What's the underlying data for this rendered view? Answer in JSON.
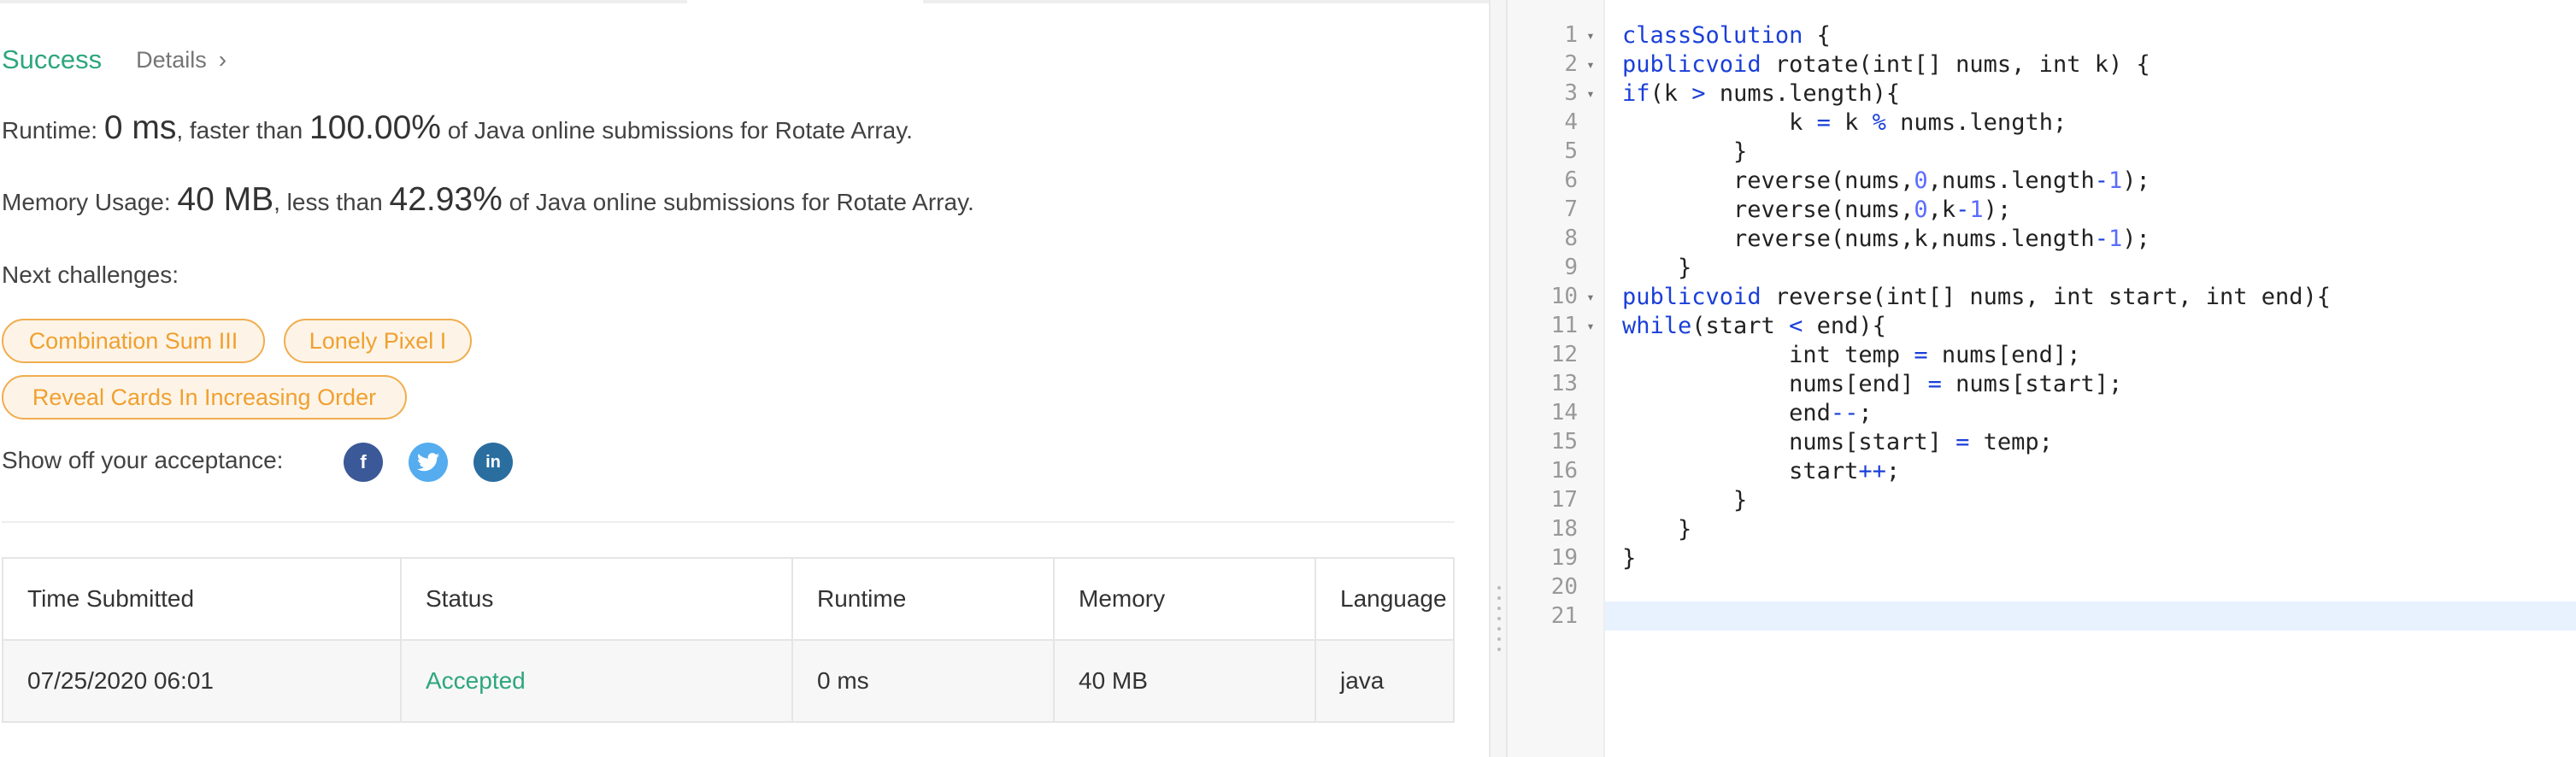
{
  "result": {
    "status": "Success",
    "details_label": "Details",
    "runtime_prefix": "Runtime: ",
    "runtime_value": "0 ms",
    "runtime_mid": ", faster than ",
    "runtime_pct": "100.00%",
    "runtime_suffix": " of Java online submissions for Rotate Array.",
    "memory_prefix": "Memory Usage: ",
    "memory_value": "40 MB",
    "memory_mid": ", less than ",
    "memory_pct": "42.93%",
    "memory_suffix": " of Java online submissions for Rotate Array."
  },
  "next_challenges": {
    "label": "Next challenges:",
    "items": [
      "Combination Sum III",
      "Lonely Pixel I",
      "Reveal Cards In Increasing Order"
    ]
  },
  "share": {
    "label": "Show off your acceptance:",
    "icons": [
      {
        "name": "facebook-icon",
        "glyph": "f",
        "color": "#3b5998"
      },
      {
        "name": "twitter-icon",
        "glyph": "t",
        "color": "#55acee"
      },
      {
        "name": "linkedin-icon",
        "glyph": "in",
        "color": "#2a6ea0"
      }
    ]
  },
  "submissions": {
    "headers": [
      "Time Submitted",
      "Status",
      "Runtime",
      "Memory",
      "Language"
    ],
    "rows": [
      [
        "07/25/2020 06:01",
        "Accepted",
        "0 ms",
        "40 MB",
        "java"
      ]
    ]
  },
  "editor": {
    "lines": [
      {
        "n": "1",
        "fold": true,
        "code": "class Solution {"
      },
      {
        "n": "2",
        "fold": true,
        "code": "    public void rotate(int[] nums, int k) {"
      },
      {
        "n": "3",
        "fold": true,
        "code": "        if(k > nums.length){"
      },
      {
        "n": "4",
        "fold": false,
        "code": "            k = k % nums.length;"
      },
      {
        "n": "5",
        "fold": false,
        "code": "        }"
      },
      {
        "n": "6",
        "fold": false,
        "code": "        reverse(nums,0,nums.length-1);"
      },
      {
        "n": "7",
        "fold": false,
        "code": "        reverse(nums,0,k-1);"
      },
      {
        "n": "8",
        "fold": false,
        "code": "        reverse(nums,k,nums.length-1);"
      },
      {
        "n": "9",
        "fold": false,
        "code": "    }"
      },
      {
        "n": "10",
        "fold": true,
        "code": "    public void reverse(int[] nums, int start, int end){"
      },
      {
        "n": "11",
        "fold": true,
        "code": "        while(start < end){"
      },
      {
        "n": "12",
        "fold": false,
        "code": "            int temp = nums[end];"
      },
      {
        "n": "13",
        "fold": false,
        "code": "            nums[end] = nums[start];"
      },
      {
        "n": "14",
        "fold": false,
        "code": "            end--;"
      },
      {
        "n": "15",
        "fold": false,
        "code": "            nums[start] = temp;"
      },
      {
        "n": "16",
        "fold": false,
        "code": "            start++;"
      },
      {
        "n": "17",
        "fold": false,
        "code": "        }"
      },
      {
        "n": "18",
        "fold": false,
        "code": "    }"
      },
      {
        "n": "19",
        "fold": false,
        "code": "}"
      },
      {
        "n": "20",
        "fold": false,
        "code": ""
      },
      {
        "n": "21",
        "fold": false,
        "code": ""
      }
    ],
    "keyword_color": "#1a3fd8",
    "number_color": "#5a6cff",
    "text_color": "#222222"
  }
}
